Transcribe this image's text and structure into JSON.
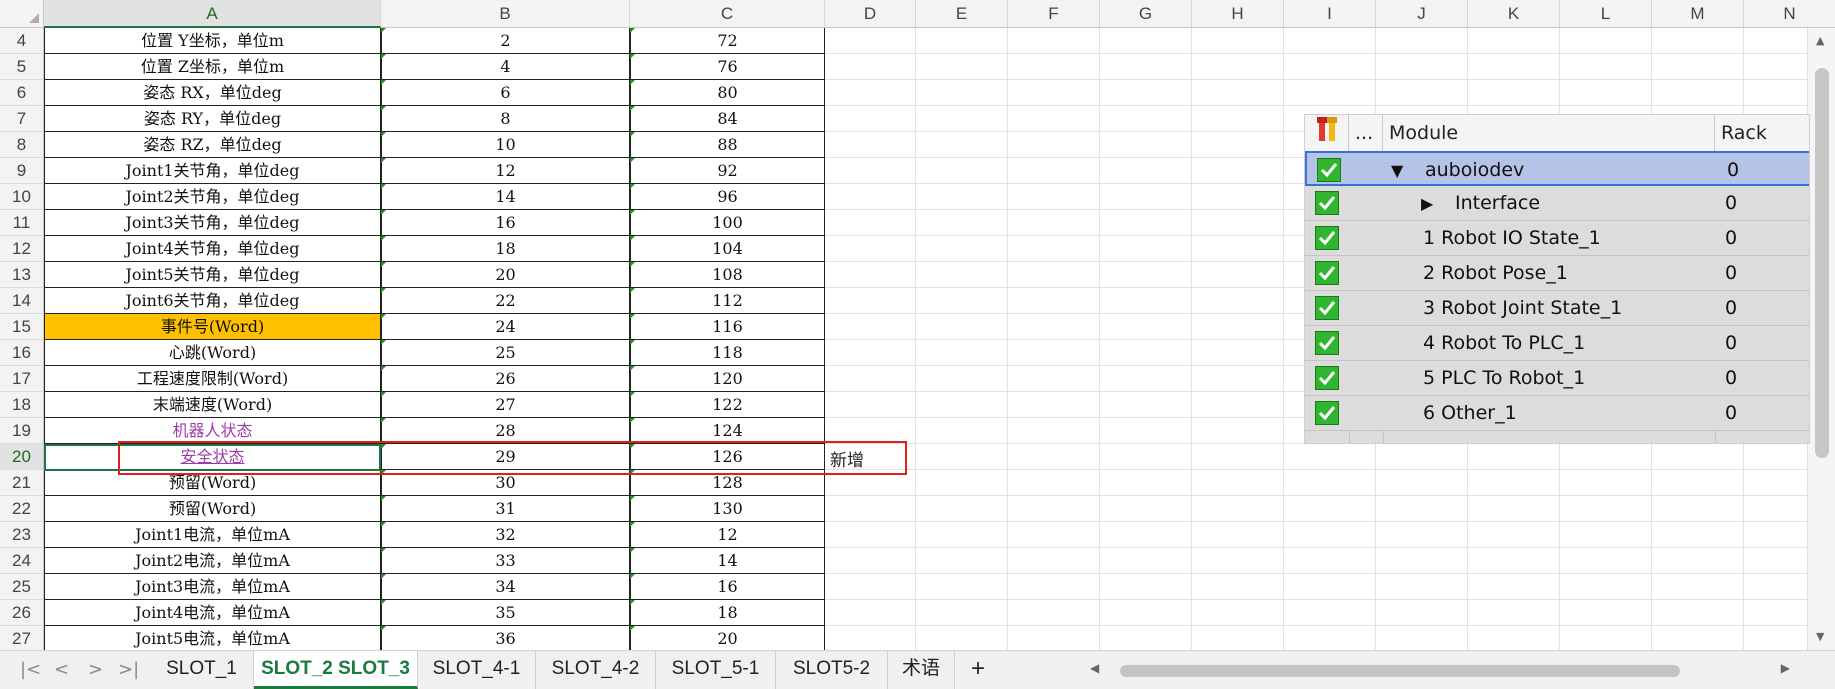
{
  "sheet": {
    "columns": [
      "A",
      "B",
      "C",
      "D",
      "E",
      "F",
      "G",
      "H",
      "I",
      "J",
      "K",
      "L",
      "M",
      "N"
    ],
    "selected_column": "A",
    "rows": [
      {
        "n": "4",
        "a": "位置 Y坐标，单位m",
        "b": "2",
        "c": "72"
      },
      {
        "n": "5",
        "a": "位置 Z坐标，单位m",
        "b": "4",
        "c": "76"
      },
      {
        "n": "6",
        "a": "姿态 RX，单位deg",
        "b": "6",
        "c": "80"
      },
      {
        "n": "7",
        "a": "姿态 RY，单位deg",
        "b": "8",
        "c": "84"
      },
      {
        "n": "8",
        "a": "姿态 RZ，单位deg",
        "b": "10",
        "c": "88"
      },
      {
        "n": "9",
        "a": "Joint1关节角，单位deg",
        "b": "12",
        "c": "92"
      },
      {
        "n": "10",
        "a": "Joint2关节角，单位deg",
        "b": "14",
        "c": "96"
      },
      {
        "n": "11",
        "a": "Joint3关节角，单位deg",
        "b": "16",
        "c": "100"
      },
      {
        "n": "12",
        "a": "Joint4关节角，单位deg",
        "b": "18",
        "c": "104"
      },
      {
        "n": "13",
        "a": "Joint5关节角，单位deg",
        "b": "20",
        "c": "108"
      },
      {
        "n": "14",
        "a": "Joint6关节角，单位deg",
        "b": "22",
        "c": "112"
      },
      {
        "n": "15",
        "a": "事件号(Word)",
        "b": "24",
        "c": "116"
      },
      {
        "n": "16",
        "a": "心跳(Word)",
        "b": "25",
        "c": "118"
      },
      {
        "n": "17",
        "a": "工程速度限制(Word)",
        "b": "26",
        "c": "120"
      },
      {
        "n": "18",
        "a": "末端速度(Word)",
        "b": "27",
        "c": "122"
      },
      {
        "n": "19",
        "a": "机器人状态",
        "b": "28",
        "c": "124"
      },
      {
        "n": "20",
        "a": "安全状态",
        "b": "29",
        "c": "126",
        "d": "新增"
      },
      {
        "n": "21",
        "a": "预留(Word)",
        "b": "30",
        "c": "128"
      },
      {
        "n": "22",
        "a": "预留(Word)",
        "b": "31",
        "c": "130"
      },
      {
        "n": "23",
        "a": "Joint1电流，单位mA",
        "b": "32",
        "c": "12"
      },
      {
        "n": "24",
        "a": "Joint2电流，单位mA",
        "b": "33",
        "c": "14"
      },
      {
        "n": "25",
        "a": "Joint3电流，单位mA",
        "b": "34",
        "c": "16"
      },
      {
        "n": "26",
        "a": "Joint4电流，单位mA",
        "b": "35",
        "c": "18"
      },
      {
        "n": "27",
        "a": "Joint5电流，单位mA",
        "b": "36",
        "c": "20"
      }
    ],
    "highlight_color": "#ffc000",
    "link_color": "#9e3ba8",
    "callout_color": "#e02020"
  },
  "module_panel": {
    "header": {
      "icon": "wrench-icon",
      "dots": "...",
      "module": "Module",
      "rack": "Rack"
    },
    "rows": [
      {
        "label": "auboiodev",
        "rack": "0",
        "expander": "expanded",
        "indent": 0,
        "selected": true
      },
      {
        "label": "Interface",
        "rack": "0",
        "expander": "collapsed",
        "indent": 1,
        "selected": false
      },
      {
        "label": "1 Robot IO State_1",
        "rack": "0",
        "expander": "",
        "indent": 0,
        "selected": false
      },
      {
        "label": "2 Robot Pose_1",
        "rack": "0",
        "expander": "",
        "indent": 0,
        "selected": false
      },
      {
        "label": "3 Robot Joint State_1",
        "rack": "0",
        "expander": "",
        "indent": 0,
        "selected": false
      },
      {
        "label": "4 Robot To PLC_1",
        "rack": "0",
        "expander": "",
        "indent": 0,
        "selected": false
      },
      {
        "label": "5 PLC To Robot_1",
        "rack": "0",
        "expander": "",
        "indent": 0,
        "selected": false
      },
      {
        "label": "6 Other_1",
        "rack": "0",
        "expander": "",
        "indent": 0,
        "selected": false
      }
    ]
  },
  "tabs": {
    "items": [
      "SLOT_1",
      "SLOT_2 SLOT_3",
      "SLOT_4-1",
      "SLOT_4-2",
      "SLOT_5-1",
      "SLOT5-2",
      "术语"
    ],
    "active_index": 1,
    "add_label": "+",
    "nav_icons": [
      "first-sheet-icon",
      "prev-sheet-icon",
      "next-sheet-icon",
      "last-sheet-icon"
    ]
  }
}
